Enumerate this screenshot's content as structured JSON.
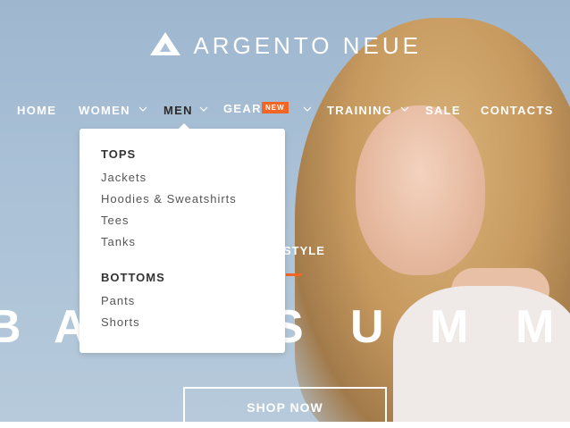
{
  "brand": {
    "name": "ARGENTO NEUE",
    "logo_icon": "mountain-logo-icon"
  },
  "nav": {
    "items": [
      {
        "label": "HOME"
      },
      {
        "label": "WOMEN"
      },
      {
        "label": "MEN"
      },
      {
        "label": "GEAR",
        "badge": "NEW"
      },
      {
        "label": "TRAINING"
      },
      {
        "label": "SALE"
      },
      {
        "label": "CONTACTS"
      }
    ],
    "chevron_icon": "chevron-down-icon"
  },
  "dropdown": {
    "sections": [
      {
        "title": "TOPS",
        "links": [
          "Jackets",
          "Hoodies & Sweatshirts",
          "Tees",
          "Tanks"
        ]
      },
      {
        "title": "BOTTOMS",
        "links": [
          "Pants",
          "Shorts"
        ]
      }
    ]
  },
  "hero": {
    "eyebrow": "STYLE",
    "letters": [
      "B",
      "A",
      "S",
      "U",
      "M",
      "M"
    ],
    "cta": "SHOP NOW"
  },
  "colors": {
    "accent": "#f26522",
    "menu_text": "#2b2b2b"
  }
}
